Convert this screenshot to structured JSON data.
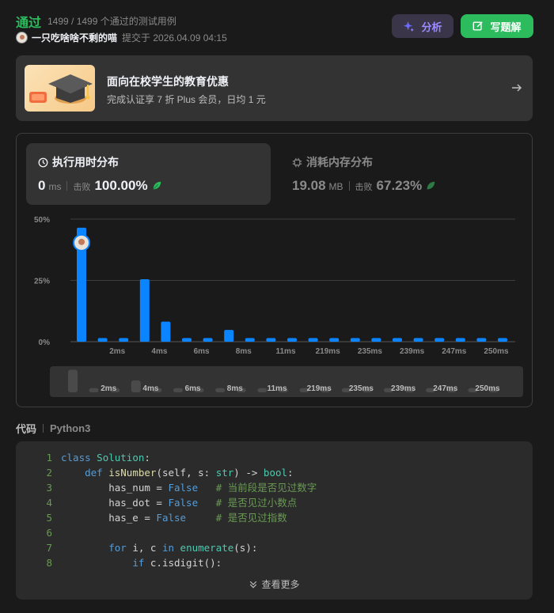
{
  "header": {
    "status": "通过",
    "cases": "1499 / 1499 个通过的测试用例",
    "username": "一只吃啥啥不剩的喵",
    "submitted": "提交于 2026.04.09 04:15",
    "analyze_label": "分析",
    "solution_label": "写题解"
  },
  "promo": {
    "title": "面向在校学生的教育优惠",
    "subtitle": "完成认证享 7 折 Plus 会员，日均 1 元"
  },
  "performance": {
    "runtime": {
      "title": "执行用时分布",
      "value": "0",
      "unit": "ms",
      "beat_label": "击败",
      "beat": "100.00%"
    },
    "memory": {
      "title": "消耗内存分布",
      "value": "19.08",
      "unit": "MB",
      "beat_label": "击败",
      "beat": "67.23%"
    }
  },
  "chart_data": {
    "type": "bar",
    "ytick_labels": [
      "50%",
      "25%",
      "0%"
    ],
    "ylim": [
      0,
      50
    ],
    "xtick_labels": [
      "2ms",
      "4ms",
      "6ms",
      "8ms",
      "11ms",
      "219ms",
      "235ms",
      "239ms",
      "247ms",
      "250ms"
    ],
    "values": [
      46.5,
      1.5,
      1.5,
      25.5,
      8.2,
      1.5,
      1.5,
      4.8,
      1.5,
      1.5,
      1.5,
      1.5,
      1.5,
      1.5,
      1.5,
      1.5,
      1.5,
      1.5,
      1.5,
      1.5,
      1.5
    ],
    "highlight_index": 0,
    "bar_color": "#0a84ff",
    "mini_values": [
      9.5,
      1.8,
      1.8,
      5.0,
      1.8,
      1.8,
      1.8,
      1.8,
      1.8,
      1.8,
      1.8,
      1.8,
      1.8,
      1.8,
      1.8,
      1.8,
      1.8,
      1.8,
      1.8,
      1.8,
      1.8
    ]
  },
  "code": {
    "label": "代码",
    "language": "Python3",
    "more_label": "查看更多",
    "lines": [
      {
        "no": "1",
        "text": "class Solution:"
      },
      {
        "no": "2",
        "text": "    def isNumber(self, s: str) -> bool:"
      },
      {
        "no": "3",
        "text": "        has_num = False   # 当前段是否见过数字"
      },
      {
        "no": "4",
        "text": "        has_dot = False   # 是否见过小数点"
      },
      {
        "no": "5",
        "text": "        has_e = False     # 是否见过指数"
      },
      {
        "no": "6",
        "text": ""
      },
      {
        "no": "7",
        "text": "        for i, c in enumerate(s):"
      },
      {
        "no": "8",
        "text": "            if c.isdigit():"
      }
    ]
  }
}
